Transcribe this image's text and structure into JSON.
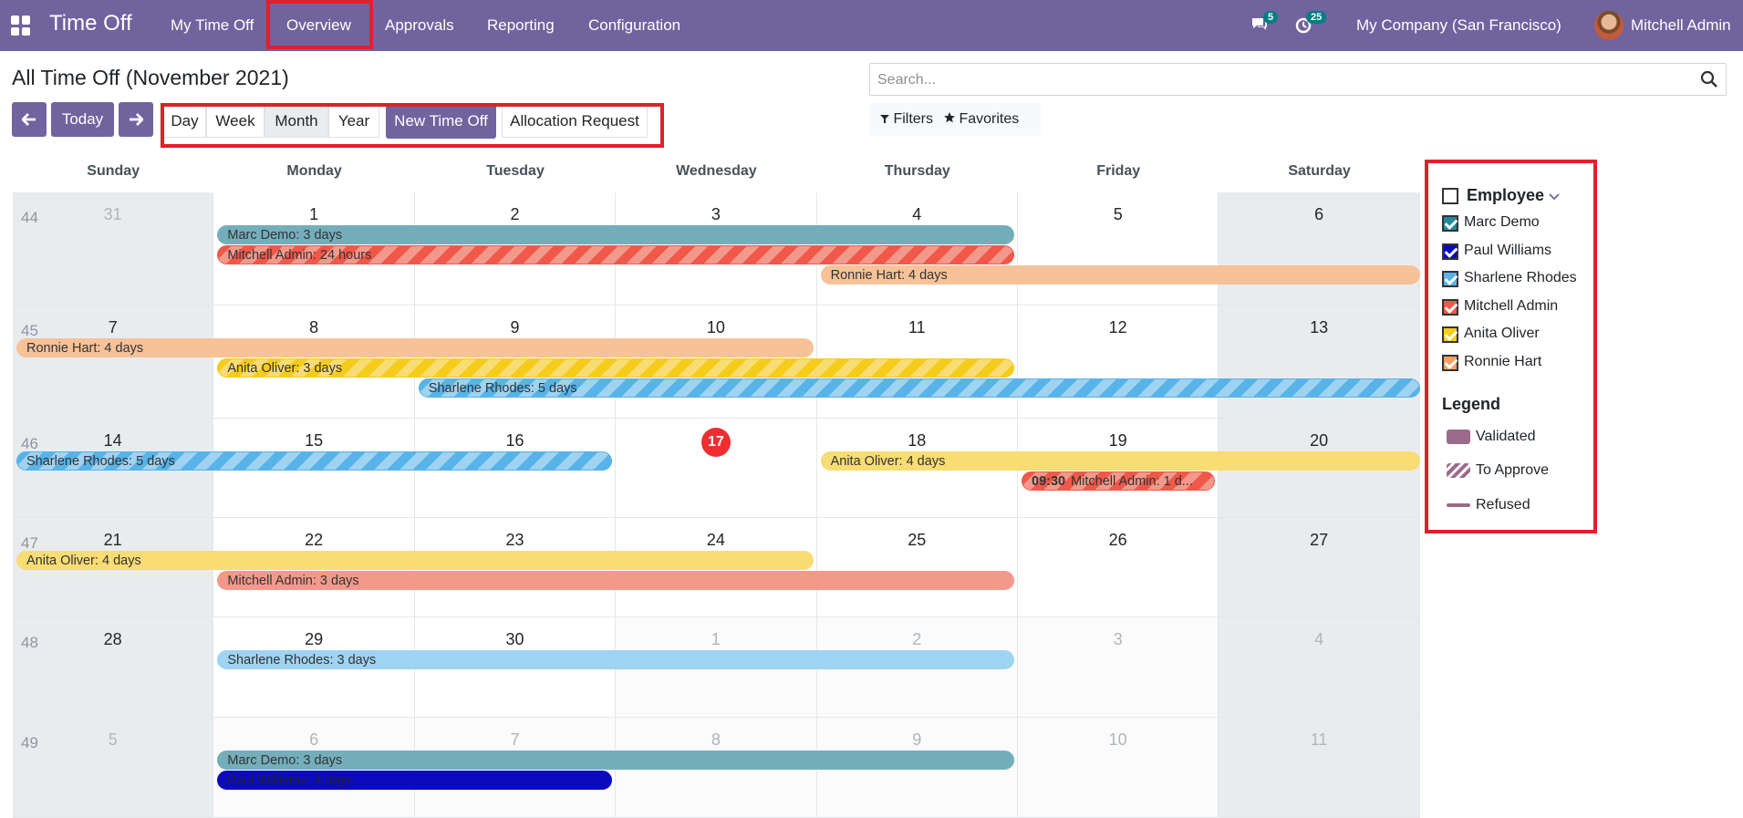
{
  "app": {
    "title": "Time Off"
  },
  "menu": [
    "My Time Off",
    "Overview",
    "Approvals",
    "Reporting",
    "Configuration"
  ],
  "systray": {
    "messages_count": "5",
    "activities_count": "25",
    "company": "My Company (San Francisco)",
    "user": "Mitchell Admin"
  },
  "page": {
    "title": "All Time Off (November 2021)"
  },
  "toolbar": {
    "today": "Today",
    "scales": [
      "Day",
      "Week",
      "Month",
      "Year"
    ],
    "active_scale": "Month",
    "new_time_off": "New Time Off",
    "allocation_request": "Allocation Request"
  },
  "search": {
    "placeholder": "Search...",
    "filters": "Filters",
    "favorites": "Favorites"
  },
  "calendar": {
    "weekdays": [
      "Sunday",
      "Monday",
      "Tuesday",
      "Wednesday",
      "Thursday",
      "Friday",
      "Saturday"
    ],
    "weeks": [
      {
        "num": "44",
        "days": [
          "31",
          "1",
          "2",
          "3",
          "4",
          "5",
          "6"
        ]
      },
      {
        "num": "45",
        "days": [
          "7",
          "8",
          "9",
          "10",
          "11",
          "12",
          "13"
        ]
      },
      {
        "num": "46",
        "days": [
          "14",
          "15",
          "16",
          "17",
          "18",
          "19",
          "20"
        ]
      },
      {
        "num": "47",
        "days": [
          "21",
          "22",
          "23",
          "24",
          "25",
          "26",
          "27"
        ]
      },
      {
        "num": "48",
        "days": [
          "28",
          "29",
          "30",
          "1",
          "2",
          "3",
          "4"
        ]
      },
      {
        "num": "49",
        "days": [
          "5",
          "6",
          "7",
          "8",
          "9",
          "10",
          "11"
        ]
      }
    ],
    "today": "17",
    "events": [
      {
        "label": "Marc Demo: 3 days",
        "employee": "Marc Demo",
        "status": "validated"
      },
      {
        "label": "Mitchell Admin: 24 hours",
        "employee": "Mitchell Admin",
        "status": "to_approve"
      },
      {
        "label": "Ronnie Hart: 4 days",
        "employee": "Ronnie Hart",
        "status": "validated"
      },
      {
        "label": "Ronnie Hart: 4 days",
        "employee": "Ronnie Hart",
        "status": "validated"
      },
      {
        "label": "Anita Oliver: 3 days",
        "employee": "Anita Oliver",
        "status": "to_approve"
      },
      {
        "label": "Sharlene Rhodes: 5 days",
        "employee": "Sharlene Rhodes",
        "status": "to_approve"
      },
      {
        "label": "Sharlene Rhodes: 5 days",
        "employee": "Sharlene Rhodes",
        "status": "to_approve"
      },
      {
        "label": "Anita Oliver: 4 days",
        "employee": "Anita Oliver",
        "status": "validated"
      },
      {
        "label": "Mitchell Admin: 1 d...",
        "time": "09:30",
        "employee": "Mitchell Admin",
        "status": "to_approve"
      },
      {
        "label": "Anita Oliver: 4 days",
        "employee": "Anita Oliver",
        "status": "validated"
      },
      {
        "label": "Mitchell Admin: 3 days",
        "employee": "Mitchell Admin",
        "status": "validated"
      },
      {
        "label": "Sharlene Rhodes: 3 days",
        "employee": "Sharlene Rhodes",
        "status": "validated"
      },
      {
        "label": "Marc Demo: 3 days",
        "employee": "Marc Demo",
        "status": "validated"
      },
      {
        "label": "Paul Williams: 4 days",
        "employee": "Paul Williams",
        "status": "to_approve"
      }
    ]
  },
  "sidebar": {
    "employee_title": "Employee",
    "employees": [
      {
        "name": "Marc Demo",
        "color": "#1f8a99"
      },
      {
        "name": "Paul Williams",
        "color": "#0b0bbd"
      },
      {
        "name": "Sharlene Rhodes",
        "color": "#57b3e8"
      },
      {
        "name": "Mitchell Admin",
        "color": "#f0584a"
      },
      {
        "name": "Anita Oliver",
        "color": "#f6cc1a"
      },
      {
        "name": "Ronnie Hart",
        "color": "#f5a05e"
      }
    ],
    "legend_title": "Legend",
    "legend": [
      "Validated",
      "To Approve",
      "Refused"
    ]
  },
  "colors": {
    "brand": "#71639e",
    "highlight": "#e0202a",
    "today": "#ef2d2f"
  }
}
